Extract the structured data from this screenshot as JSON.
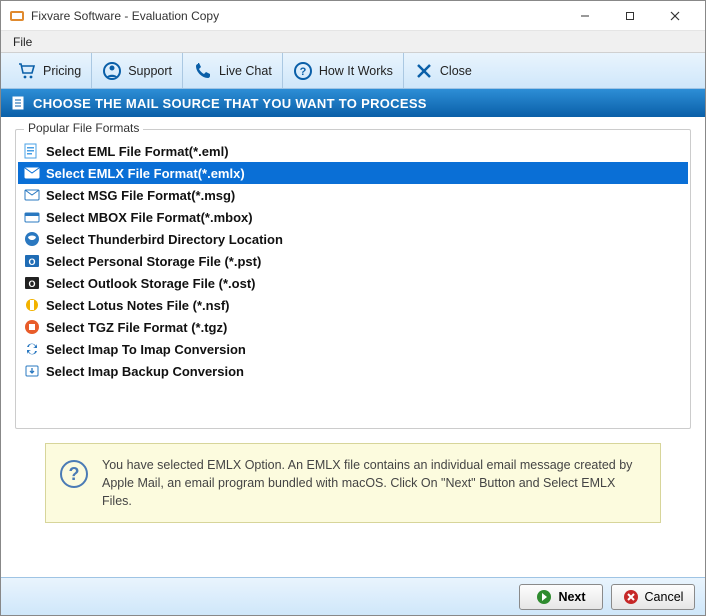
{
  "window": {
    "title": "Fixvare Software - Evaluation Copy"
  },
  "menubar": {
    "file": "File"
  },
  "toolbar": {
    "pricing": "Pricing",
    "support": "Support",
    "livechat": "Live Chat",
    "howitworks": "How It Works",
    "close": "Close"
  },
  "header": {
    "title": "CHOOSE THE MAIL SOURCE THAT YOU WANT TO PROCESS"
  },
  "groupbox": {
    "label": "Popular File Formats"
  },
  "formats": {
    "eml": "Select EML File Format(*.eml)",
    "emlx": "Select EMLX File Format(*.emlx)",
    "msg": "Select MSG File Format(*.msg)",
    "mbox": "Select MBOX File Format(*.mbox)",
    "thunderbird": "Select Thunderbird Directory Location",
    "pst": "Select Personal Storage File (*.pst)",
    "ost": "Select Outlook Storage File (*.ost)",
    "nsf": "Select Lotus Notes File (*.nsf)",
    "tgz": "Select TGZ File Format (*.tgz)",
    "imap2imap": "Select Imap To Imap Conversion",
    "imapbackup": "Select Imap Backup Conversion"
  },
  "info": {
    "text": "You have selected EMLX Option. An EMLX file contains an individual email message created by Apple Mail, an email program bundled with macOS. Click On \"Next\" Button and Select EMLX Files."
  },
  "buttons": {
    "next": "Next",
    "cancel": "Cancel"
  }
}
